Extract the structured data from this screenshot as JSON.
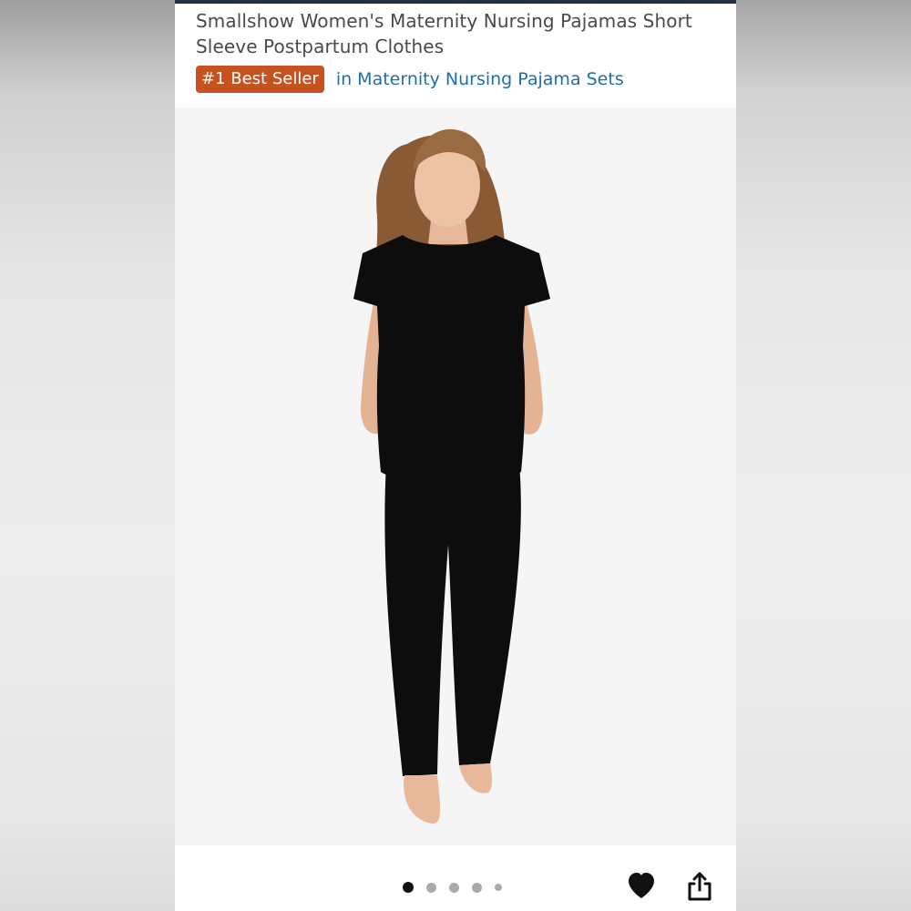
{
  "product": {
    "title": "Smallshow Women's Maternity Nursing Pajamas Short Sleeve Postpartum Clothes",
    "badge": "#1 Best Seller",
    "category_link": "in Maternity Nursing Pajama Sets"
  },
  "carousel": {
    "total_images": 5,
    "active_index": 0
  },
  "icons": {
    "favorite": "heart-icon",
    "share": "share-icon"
  },
  "colors": {
    "badge_background": "#c7511f",
    "link": "#1f6fa7",
    "garment": "#0d0d0d"
  }
}
